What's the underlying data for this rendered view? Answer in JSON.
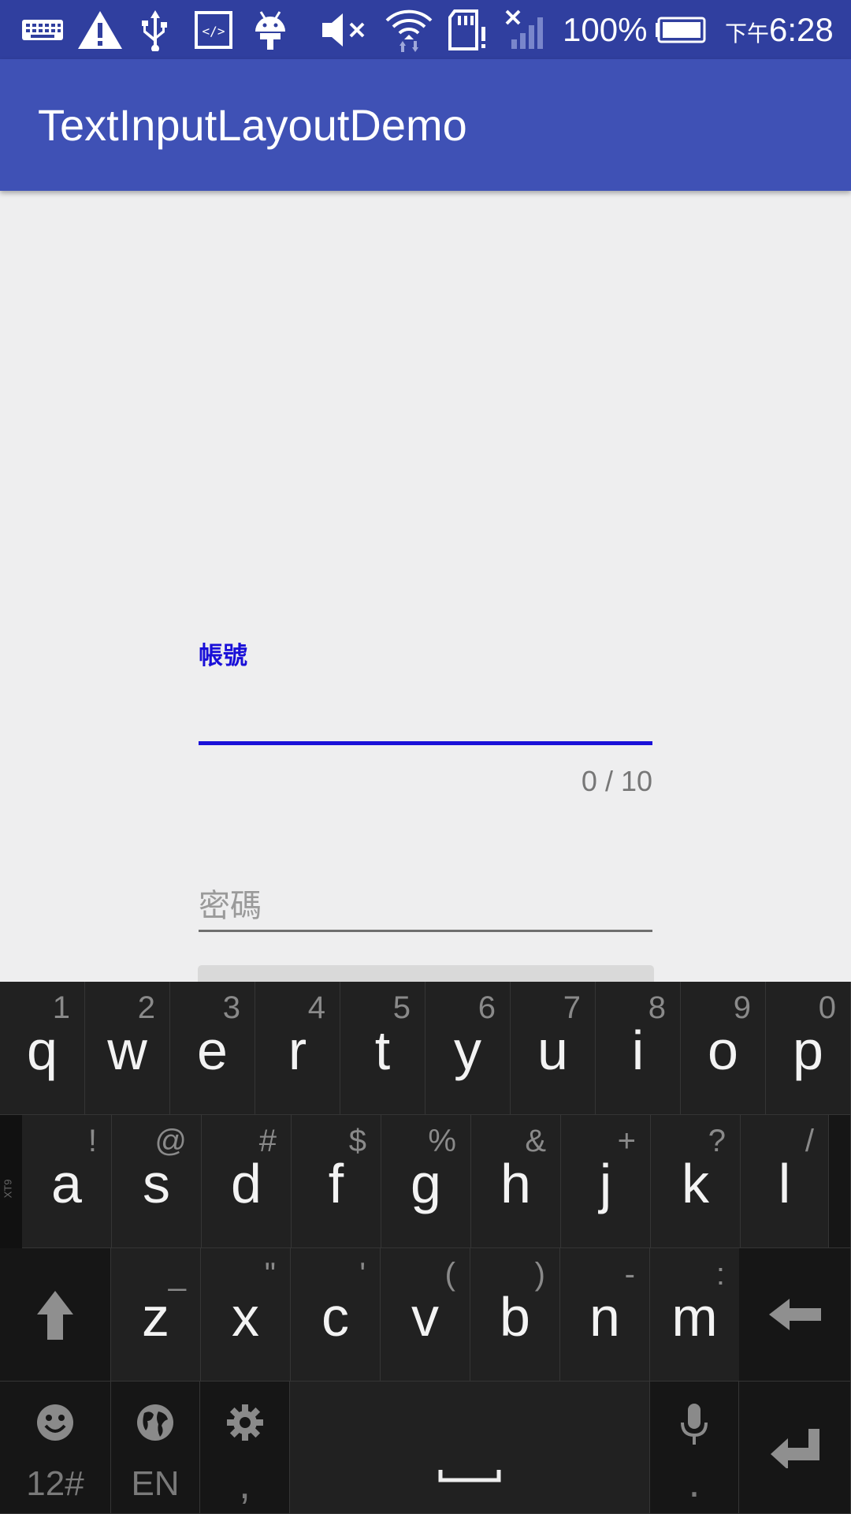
{
  "status_bar": {
    "icons": [
      "keyboard-icon",
      "warning-icon",
      "usb-icon",
      "code-icon",
      "android-icon",
      "mute-icon",
      "wifi-icon",
      "sd-card-alert-icon",
      "no-signal-icon",
      "battery-icon"
    ],
    "battery": "100%",
    "time_prefix": "下午",
    "time": "6:28"
  },
  "app_bar": {
    "title": "TextInputLayoutDemo"
  },
  "form": {
    "account_label": "帳號",
    "account_counter": "0 / 10",
    "password_hint": "密碼"
  },
  "keyboard": {
    "row1": [
      {
        "label": "q",
        "hint": "1"
      },
      {
        "label": "w",
        "hint": "2"
      },
      {
        "label": "e",
        "hint": "3"
      },
      {
        "label": "r",
        "hint": "4"
      },
      {
        "label": "t",
        "hint": "5"
      },
      {
        "label": "y",
        "hint": "6"
      },
      {
        "label": "u",
        "hint": "7"
      },
      {
        "label": "i",
        "hint": "8"
      },
      {
        "label": "o",
        "hint": "9"
      },
      {
        "label": "p",
        "hint": "0"
      }
    ],
    "row2": [
      {
        "label": "a",
        "hint": "!"
      },
      {
        "label": "s",
        "hint": "@"
      },
      {
        "label": "d",
        "hint": "#"
      },
      {
        "label": "f",
        "hint": "$"
      },
      {
        "label": "g",
        "hint": "%"
      },
      {
        "label": "h",
        "hint": "&"
      },
      {
        "label": "j",
        "hint": "+"
      },
      {
        "label": "k",
        "hint": "?"
      },
      {
        "label": "l",
        "hint": "/"
      }
    ],
    "row3": [
      {
        "label": "z",
        "hint": "_"
      },
      {
        "label": "x",
        "hint": "\""
      },
      {
        "label": "c",
        "hint": "'"
      },
      {
        "label": "v",
        "hint": "("
      },
      {
        "label": "b",
        "hint": ")"
      },
      {
        "label": "n",
        "hint": "-"
      },
      {
        "label": "m",
        "hint": ":"
      }
    ],
    "xt9_label": "XT9",
    "symbols_label": "12#",
    "language_label": "EN",
    "comma_label": ",",
    "period_label": "."
  }
}
